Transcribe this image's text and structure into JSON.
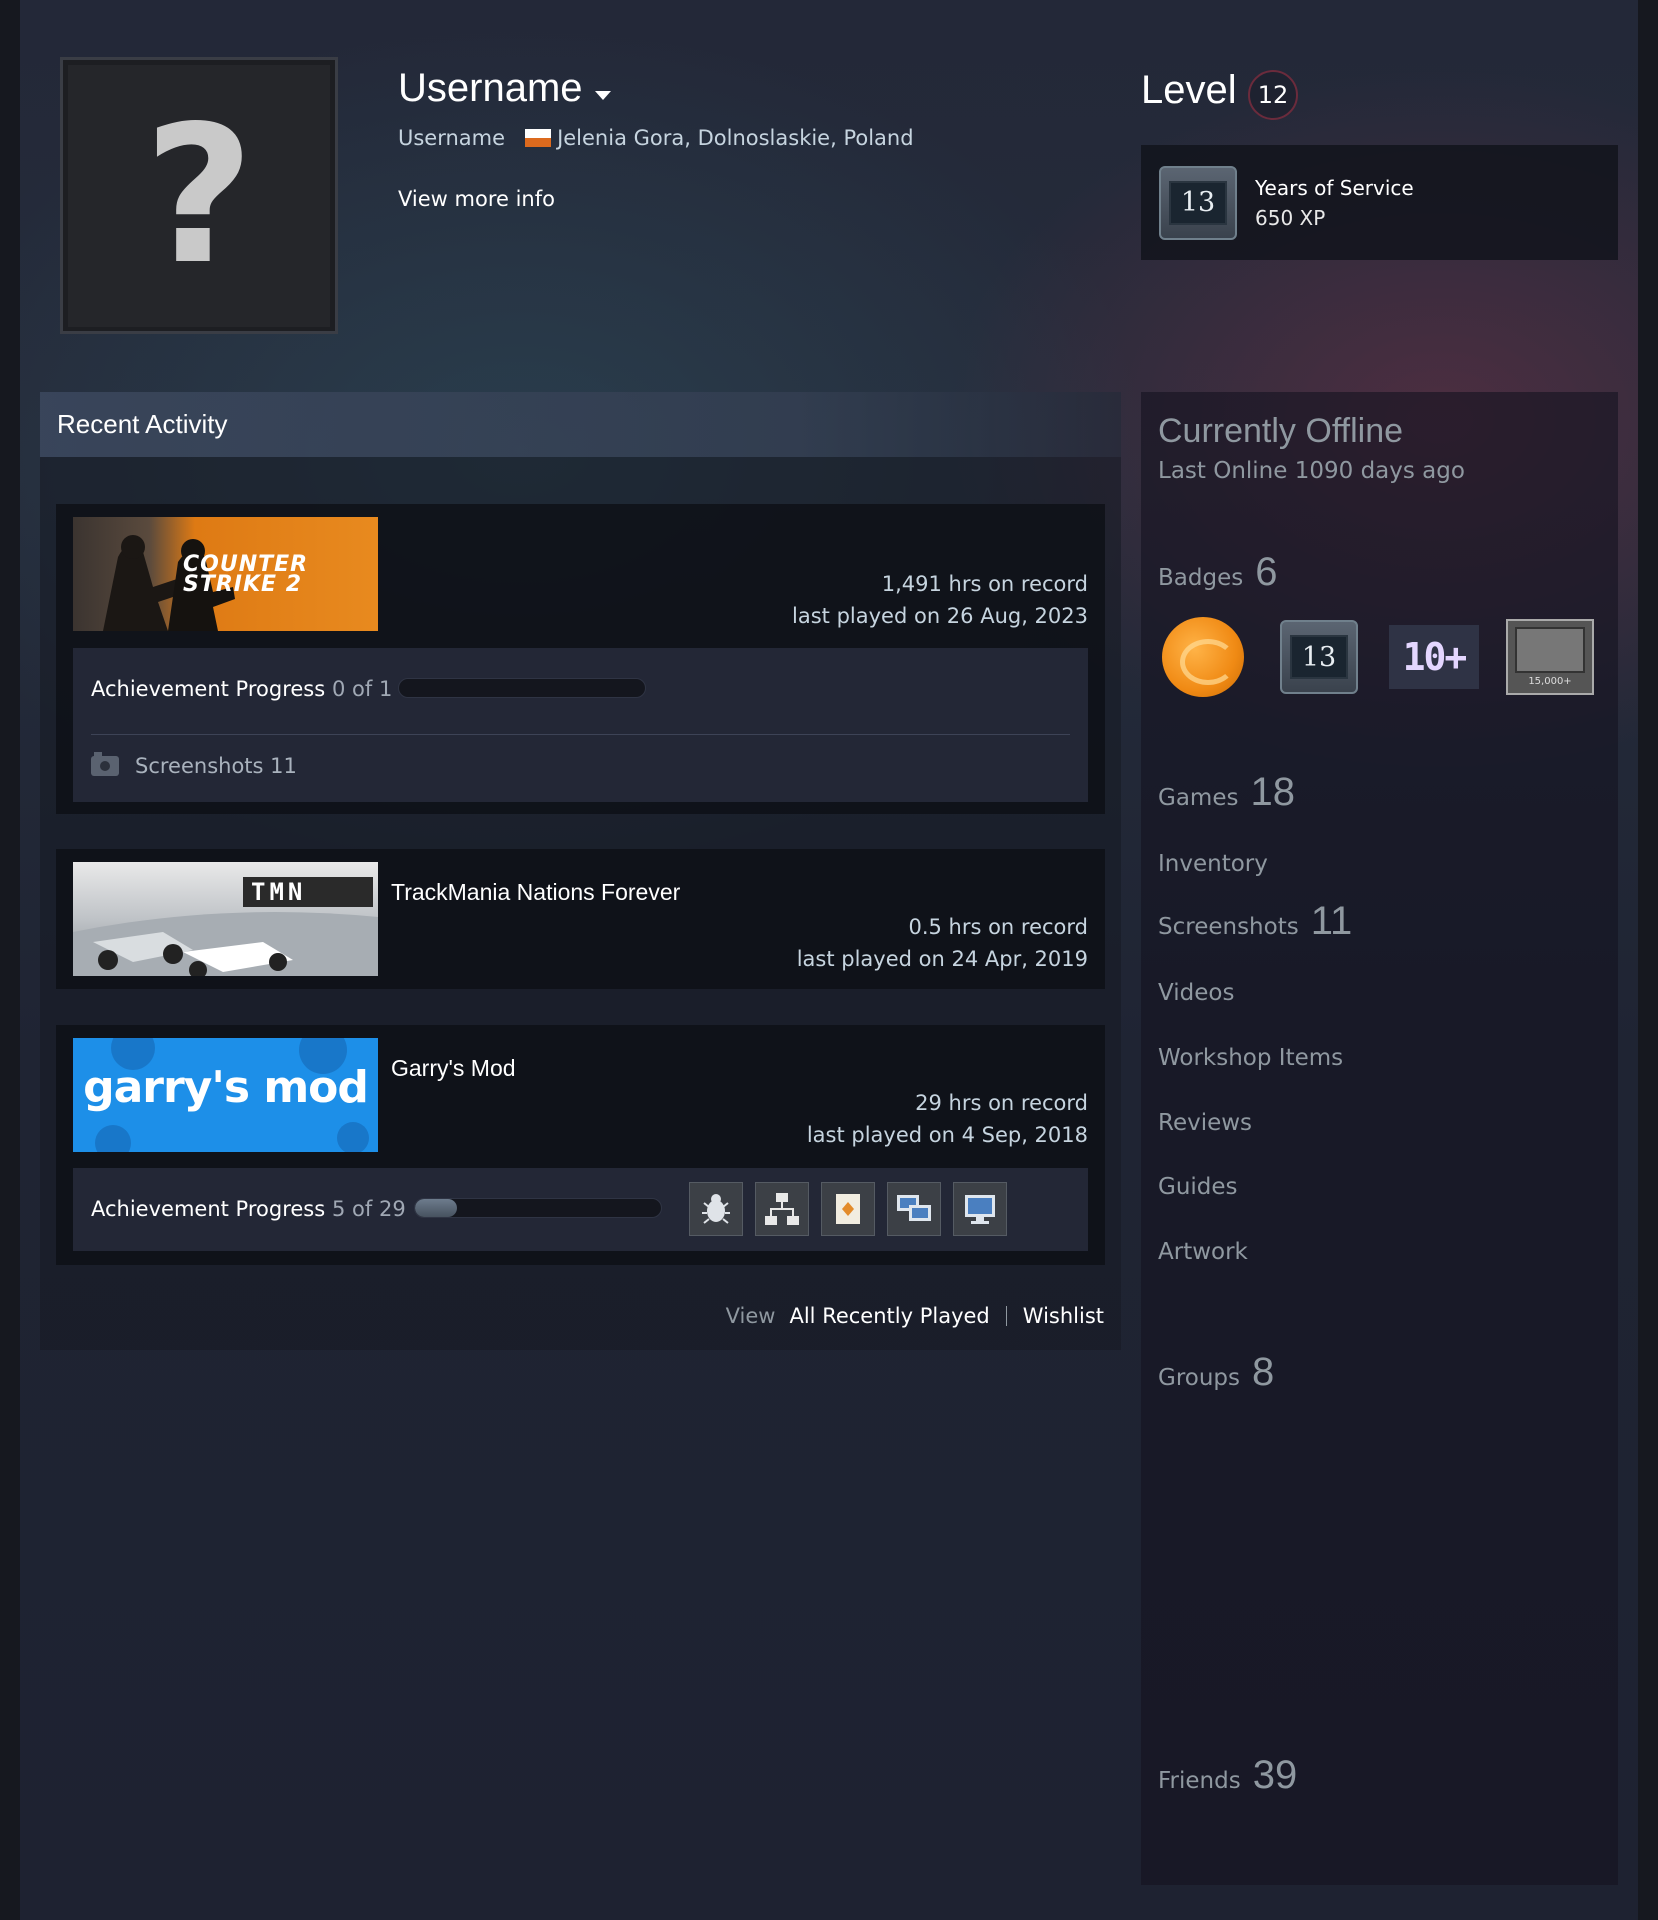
{
  "profile": {
    "username": "Username",
    "real_name": "Username",
    "location": "Jelenia Gora, Dolnoslaskie, Poland",
    "view_more": "View more info",
    "avatar_glyph": "?"
  },
  "level": {
    "label": "Level",
    "value": "12",
    "featured_badge": {
      "number": "13",
      "title": "Years of Service",
      "xp": "650 XP"
    }
  },
  "recent_activity": {
    "title": "Recent Activity",
    "games": [
      {
        "name": "",
        "capsule_text": "COUNTER STRIKE 2",
        "hours": "1,491 hrs on record",
        "last_played": "last played on 26 Aug, 2023",
        "achievement_label": "Achievement Progress",
        "achievement_count": "0 of 1",
        "achievement_fraction": 0.0,
        "screenshots": "Screenshots 11"
      },
      {
        "name": "TrackMania Nations Forever",
        "capsule_text": "TMN",
        "hours": "0.5 hrs on record",
        "last_played": "last played on 24 Apr, 2019"
      },
      {
        "name": "Garry's Mod",
        "capsule_text": "garry's mod",
        "hours": "29 hrs on record",
        "last_played": "last played on 4 Sep, 2018",
        "achievement_label": "Achievement Progress",
        "achievement_count": "5 of 29",
        "achievement_fraction": 0.17,
        "achievement_icons": [
          "bug-icon",
          "network-icon",
          "card-icon",
          "monitors-icon",
          "monitor-icon"
        ]
      }
    ],
    "footer": {
      "view_label": "View",
      "recently_played": "All Recently Played",
      "wishlist": "Wishlist"
    }
  },
  "sidebar": {
    "status": "Currently Offline",
    "last_online": "Last Online 1090 days ago",
    "badges_label": "Badges",
    "badges_count": "6",
    "badge_13": "13",
    "badge_10": "10+",
    "badge_tv_caption": "15,000+",
    "games_label": "Games",
    "games_count": "18",
    "inventory": "Inventory",
    "screenshots_label": "Screenshots",
    "screenshots_count": "11",
    "videos": "Videos",
    "workshop": "Workshop Items",
    "reviews": "Reviews",
    "guides": "Guides",
    "artwork": "Artwork",
    "groups_label": "Groups",
    "groups_count": "8",
    "friends_label": "Friends",
    "friends_count": "39"
  },
  "colors": {
    "background": "#1e2231",
    "text": "#c6d4df",
    "muted": "#8f98a0",
    "level_ring": "#6b2b3c",
    "cs2_orange": "#de7a14",
    "gmod_blue": "#1d8fe8"
  }
}
